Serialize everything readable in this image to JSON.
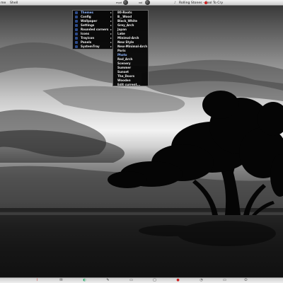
{
  "top_panel": {
    "left_text": "me",
    "shell_label": "Shell",
    "knob1_label": "mpd",
    "knob2_label": "vol",
    "now_playing": "Rolling Stones - Fool To Cry"
  },
  "menu_main": {
    "items": [
      {
        "label": "Themes",
        "active": true
      },
      {
        "label": "Config",
        "active": false
      },
      {
        "label": "Wallpaper",
        "active": false
      },
      {
        "label": "Settings",
        "active": false
      },
      {
        "label": "Rounded corners",
        "active": false
      },
      {
        "label": "Icons",
        "active": false
      },
      {
        "label": "Trayicon",
        "active": false
      },
      {
        "label": "Panels",
        "active": false
      },
      {
        "label": "SystemTray",
        "active": false
      }
    ]
  },
  "menu_themes": {
    "items": [
      {
        "label": "80-Roots",
        "active": false
      },
      {
        "label": "B__Wood",
        "active": false
      },
      {
        "label": "Black_White",
        "active": false
      },
      {
        "label": "Grey_Arch",
        "active": false
      },
      {
        "label": "Japan",
        "active": false
      },
      {
        "label": "Lake",
        "active": false
      },
      {
        "label": "Minimal-Arch",
        "active": false
      },
      {
        "label": "New Style",
        "active": false
      },
      {
        "label": "New-Minimal-Arch",
        "active": false
      },
      {
        "label": "Paris",
        "active": false
      },
      {
        "label": "Photo",
        "active": true
      },
      {
        "label": "Red_Arch",
        "active": false
      },
      {
        "label": "Scenery",
        "active": false
      },
      {
        "label": "Summer",
        "active": false
      },
      {
        "label": "Sunset",
        "active": false
      },
      {
        "label": "The_Doors",
        "active": false
      },
      {
        "label": "Wooden",
        "active": false
      },
      {
        "label": "Edit current...",
        "active": false
      }
    ]
  },
  "bottom_panel": {
    "icons": [
      "graph-icon",
      "mail-icon",
      "globe-icon",
      "tools-icon",
      "window-icon",
      "terminal-icon",
      "record-icon",
      "clock-icon",
      "power-icon"
    ]
  },
  "colors": {
    "menu_bg": "#050505",
    "menu_text": "#e8e8e8",
    "menu_active": "#8fb6ff",
    "icon_blue": "#2d4b8a"
  }
}
